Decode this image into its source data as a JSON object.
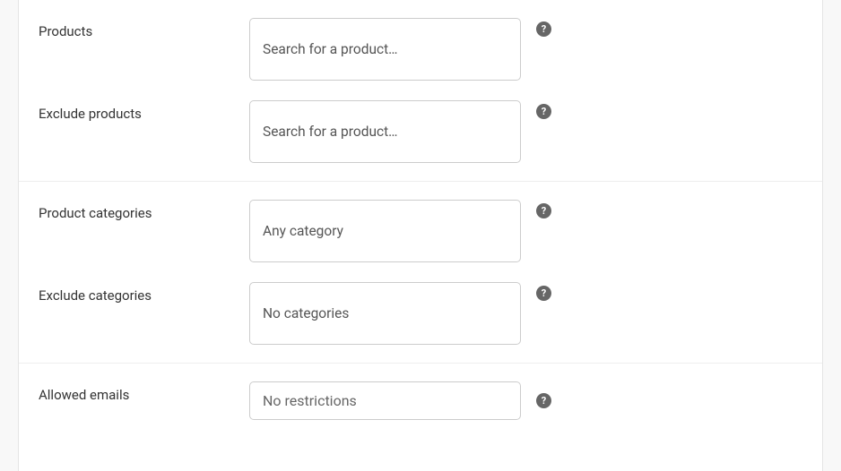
{
  "fields": {
    "products": {
      "label": "Products",
      "placeholder": "Search for a product…"
    },
    "exclude_products": {
      "label": "Exclude products",
      "placeholder": "Search for a product…"
    },
    "product_categories": {
      "label": "Product categories",
      "placeholder": "Any category"
    },
    "exclude_categories": {
      "label": "Exclude categories",
      "placeholder": "No categories"
    },
    "allowed_emails": {
      "label": "Allowed emails",
      "placeholder": "No restrictions"
    }
  },
  "help_glyph": "?"
}
